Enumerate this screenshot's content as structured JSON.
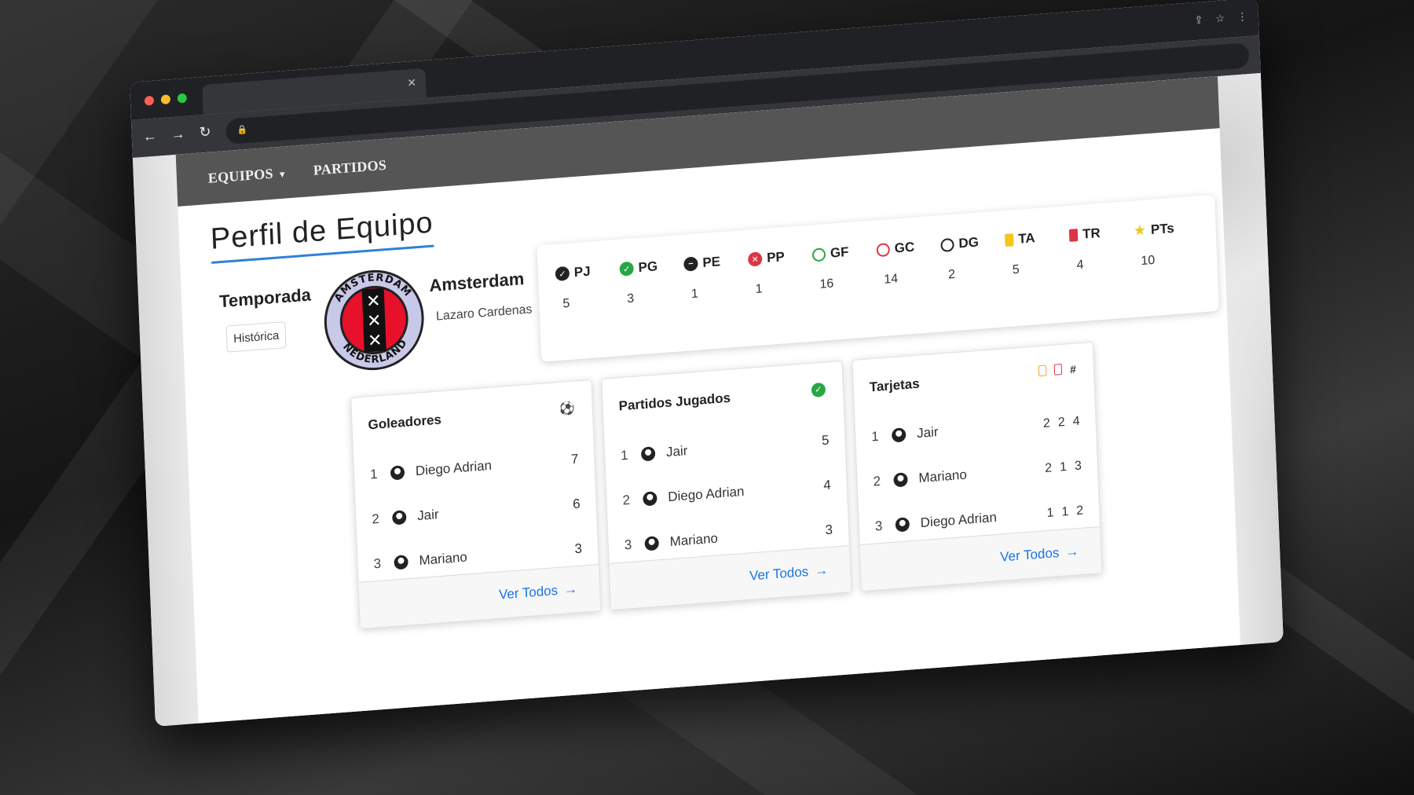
{
  "nav": {
    "teams_label": "EQUIPOS",
    "matches_label": "PARTIDOS"
  },
  "page_title": "Perfil de Equipo",
  "season": {
    "label": "Temporada",
    "selected": "Histórica"
  },
  "team": {
    "name": "Amsterdam",
    "coach": "Lazaro Cardenas",
    "logo_top_text": "AMSTERDAM",
    "logo_bottom_text": "NEDERLAND"
  },
  "stats": [
    {
      "key": "PJ",
      "value": "5",
      "icon": "check-circle-icon",
      "color": "#222222"
    },
    {
      "key": "PG",
      "value": "3",
      "icon": "check-circle-icon",
      "color": "#28a745"
    },
    {
      "key": "PE",
      "value": "1",
      "icon": "minus-circle-icon",
      "color": "#222222"
    },
    {
      "key": "PP",
      "value": "1",
      "icon": "x-circle-icon",
      "color": "#dc3545"
    },
    {
      "key": "GF",
      "value": "16",
      "icon": "soccer-ball-icon",
      "color": "#28a745"
    },
    {
      "key": "GC",
      "value": "14",
      "icon": "soccer-ball-icon",
      "color": "#dc3545"
    },
    {
      "key": "DG",
      "value": "2",
      "icon": "soccer-ball-icon",
      "color": "#222222"
    },
    {
      "key": "TA",
      "value": "5",
      "icon": "yellow-card-icon",
      "color": "#f5c518"
    },
    {
      "key": "TR",
      "value": "4",
      "icon": "red-card-icon",
      "color": "#dc3545"
    },
    {
      "key": "PTs",
      "value": "10",
      "icon": "star-icon",
      "color": "#f5c518"
    }
  ],
  "scorers": {
    "title": "Goleadores",
    "rows": [
      {
        "rank": "1",
        "name": "Diego Adrian",
        "value": "7"
      },
      {
        "rank": "2",
        "name": "Jair",
        "value": "6"
      },
      {
        "rank": "3",
        "name": "Mariano",
        "value": "3"
      }
    ],
    "link": "Ver Todos"
  },
  "played": {
    "title": "Partidos Jugados",
    "rows": [
      {
        "rank": "1",
        "name": "Jair",
        "value": "5"
      },
      {
        "rank": "2",
        "name": "Diego Adrian",
        "value": "4"
      },
      {
        "rank": "3",
        "name": "Mariano",
        "value": "3"
      }
    ],
    "link": "Ver Todos"
  },
  "cards": {
    "title": "Tarjetas",
    "hash": "#",
    "rows": [
      {
        "rank": "1",
        "name": "Jair",
        "yellow": "2",
        "red": "2",
        "total": "4"
      },
      {
        "rank": "2",
        "name": "Mariano",
        "yellow": "2",
        "red": "1",
        "total": "3"
      },
      {
        "rank": "3",
        "name": "Diego Adrian",
        "yellow": "1",
        "red": "1",
        "total": "2"
      }
    ],
    "link": "Ver Todos"
  }
}
